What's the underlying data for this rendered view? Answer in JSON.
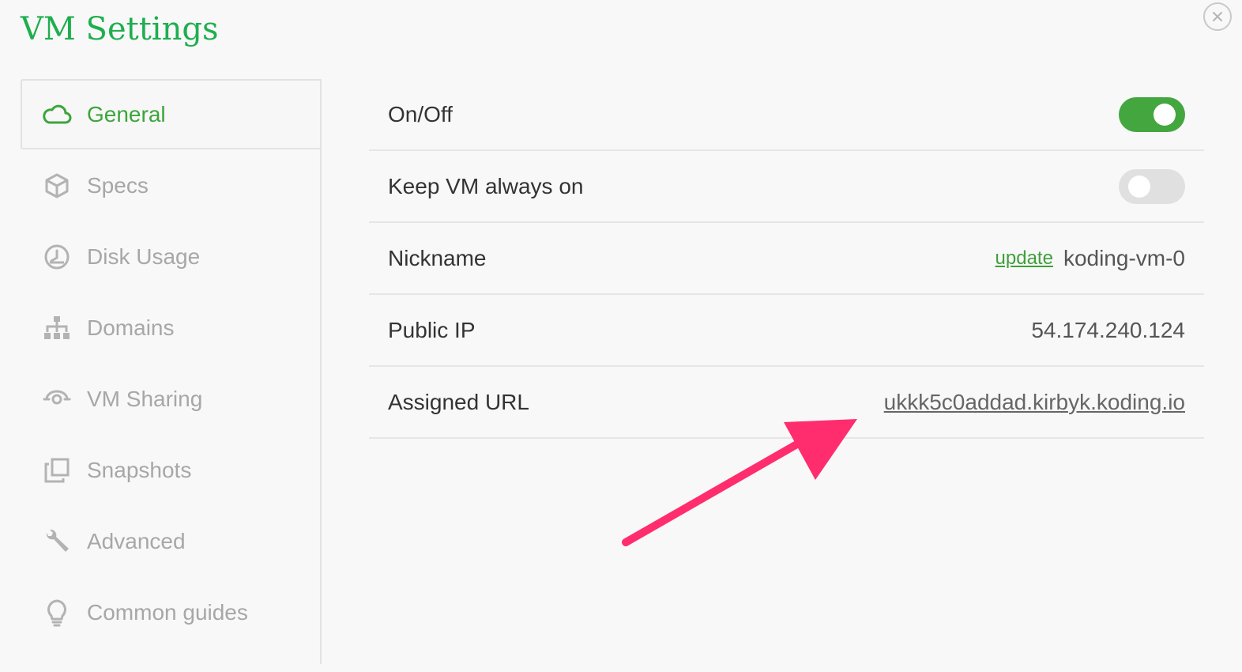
{
  "header": {
    "title": "VM Settings",
    "close_icon": "close-icon"
  },
  "sidebar": {
    "items": [
      {
        "label": "General",
        "icon": "cloud-icon",
        "active": true
      },
      {
        "label": "Specs",
        "icon": "cube-icon",
        "active": false
      },
      {
        "label": "Disk Usage",
        "icon": "gauge-icon",
        "active": false
      },
      {
        "label": "Domains",
        "icon": "sitemap-icon",
        "active": false
      },
      {
        "label": "VM Sharing",
        "icon": "share-icon",
        "active": false
      },
      {
        "label": "Snapshots",
        "icon": "snapshots-icon",
        "active": false
      },
      {
        "label": "Advanced",
        "icon": "wrench-icon",
        "active": false
      },
      {
        "label": "Common guides",
        "icon": "lightbulb-icon",
        "active": false
      }
    ]
  },
  "general": {
    "onoff": {
      "label": "On/Off",
      "enabled": true
    },
    "always_on": {
      "label": "Keep VM always on",
      "enabled": false
    },
    "nickname": {
      "label": "Nickname",
      "update_label": "update",
      "value": "koding-vm-0"
    },
    "public_ip": {
      "label": "Public IP",
      "value": "54.174.240.124"
    },
    "assigned_url": {
      "label": "Assigned URL",
      "value": "ukkk5c0addad.kirbyk.koding.io"
    }
  },
  "colors": {
    "accent": "#1fae4f",
    "toggle_on": "#44a63f",
    "toggle_off": "#e0e0e0",
    "annotation_arrow": "#ff2d6e"
  }
}
